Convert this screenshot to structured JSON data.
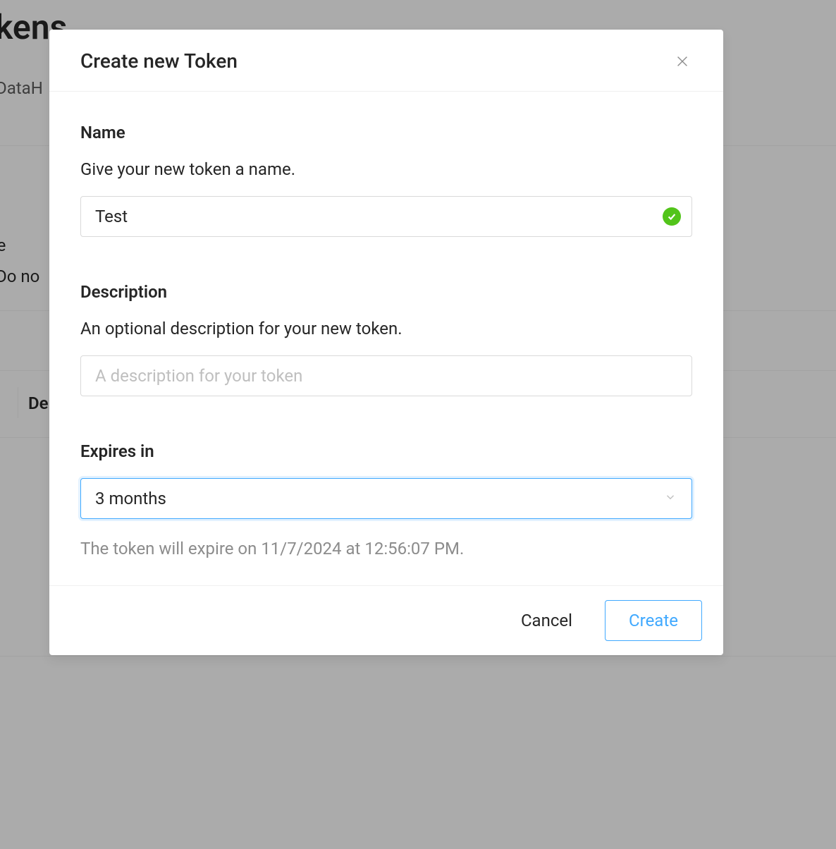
{
  "background": {
    "title": "Tokens",
    "subtitle": "DataH",
    "line1": "o make",
    "line2": "Do no",
    "tab_label": "De"
  },
  "modal": {
    "title": "Create new Token",
    "name": {
      "label": "Name",
      "help": "Give your new token a name.",
      "value": "Test"
    },
    "description": {
      "label": "Description",
      "help": "An optional description for your new token.",
      "placeholder": "A description for your token",
      "value": ""
    },
    "expires": {
      "label": "Expires in",
      "selected": "3 months",
      "note": "The token will expire on 11/7/2024 at 12:56:07 PM."
    },
    "footer": {
      "cancel": "Cancel",
      "create": "Create"
    }
  }
}
